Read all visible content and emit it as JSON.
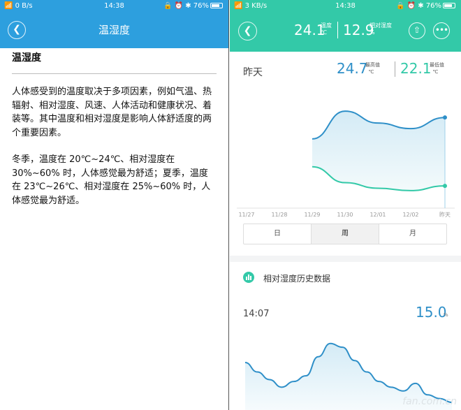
{
  "left": {
    "status": {
      "signal": "📶",
      "speed": "0 B/s",
      "time": "14:38",
      "icons": "🔒 ⏰ ✱",
      "battery": "76%"
    },
    "title": "温湿度",
    "article": {
      "heading": "温湿度",
      "p1": "人体感受到的温度取决于多项因素，例如气温、热辐射、相对湿度、风速、人体活动和健康状况、着装等。其中温度和相对湿度是影响人体舒适度的两个重要因素。",
      "p2": "冬季，温度在 20℃~24℃、相对湿度在 30%~60% 时，人体感觉最为舒适；夏季，温度在 23℃~26℃、相对湿度在 25%~60% 时，人体感觉最为舒适。"
    }
  },
  "right": {
    "status": {
      "signal": "📶",
      "speed": "3 KB/s",
      "time": "14:38",
      "icons": "🔒 ⏰ ✱",
      "battery": "76%"
    },
    "header": {
      "temperature": "24.1",
      "temp_label": "温度",
      "temp_unit": "℃",
      "humidity": "12.9",
      "hum_label": "相对湿度",
      "hum_unit": "%"
    },
    "summary": {
      "day_label": "昨天",
      "max_value": "24.7",
      "max_label": "最高值",
      "max_unit": "℃",
      "min_value": "22.1",
      "min_label": "最低值",
      "min_unit": "℃"
    },
    "chart_data": {
      "type": "area",
      "x": [
        "11/27",
        "11/28",
        "11/29",
        "11/30",
        "12/01",
        "12/02",
        "昨天"
      ],
      "series": [
        {
          "values": [
            null,
            null,
            22.0,
            25.5,
            24.0,
            23.3,
            24.7
          ]
        },
        {
          "values": [
            null,
            null,
            18.5,
            16.5,
            15.8,
            15.5,
            16.1
          ]
        }
      ],
      "colors": {
        "max": "#2e8fc8",
        "min": "#33c9a8"
      }
    },
    "tabs": [
      "日",
      "周",
      "月"
    ],
    "active_tab": "周",
    "history": {
      "title": "相对湿度历史数据",
      "time": "14:07",
      "value": "15.0",
      "unit": "%"
    },
    "history_chart_data": {
      "type": "area",
      "values": [
        12.5,
        10,
        8,
        6,
        7.5,
        9,
        14,
        17.5,
        16.5,
        13,
        10,
        7.5,
        6,
        5,
        7,
        4,
        3,
        2
      ]
    },
    "watermark": "fan.com.cn",
    "colors": {
      "accent_green": "#33c9a8",
      "accent_blue": "#2d9fde",
      "line_blue": "#2e8fc8"
    }
  }
}
